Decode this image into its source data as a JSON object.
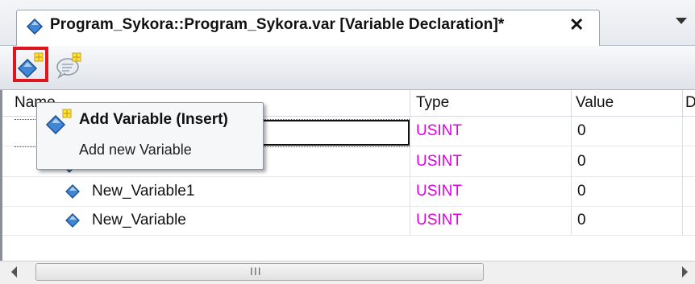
{
  "tab": {
    "title": "Program_Sykora::Program_Sykora.var [Variable Declaration]*",
    "close": "✕",
    "icon": "variable-diamond-icon"
  },
  "toolbar": {
    "add_variable_icon": "add-variable-icon",
    "add_comment_icon": "add-comment-icon",
    "highlight_color": "#e0141e"
  },
  "grid": {
    "columns": [
      "Name",
      "Type",
      "Value",
      "D"
    ],
    "rows": [
      {
        "name": "",
        "type": "USINT",
        "value": "0"
      },
      {
        "name": "",
        "type": "USINT",
        "value": "0"
      },
      {
        "name": "New_Variable1",
        "type": "USINT",
        "value": "0"
      },
      {
        "name": "New_Variable",
        "type": "USINT",
        "value": "0"
      }
    ],
    "type_color": "#e100e1"
  },
  "menu": {
    "title": "Add Variable (Insert)",
    "subtitle": "Add new Variable"
  },
  "scrollbar": {
    "grip": "III"
  }
}
